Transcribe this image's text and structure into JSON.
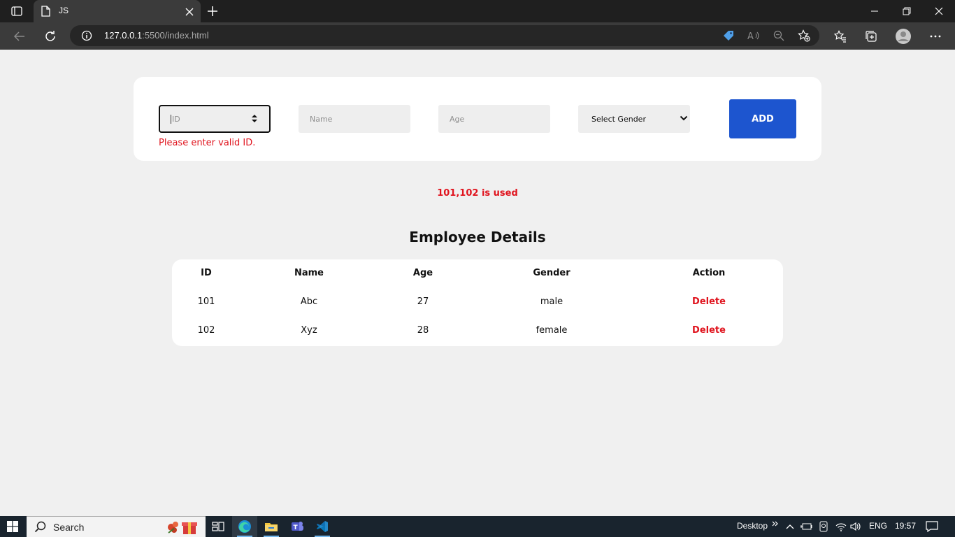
{
  "browser": {
    "tab_title": "JS",
    "url_host": "127.0.0.1",
    "url_path": ":5500/index.html"
  },
  "form": {
    "id_placeholder": "ID",
    "name_placeholder": "Name",
    "age_placeholder": "Age",
    "gender_selected": "Select Gender",
    "add_label": "ADD",
    "error_text": "Please enter valid ID."
  },
  "used_message": "101,102 is used",
  "table": {
    "title": "Employee Details",
    "headers": [
      "ID",
      "Name",
      "Age",
      "Gender",
      "Action"
    ],
    "rows": [
      {
        "id": "101",
        "name": "Abc",
        "age": "27",
        "gender": "male",
        "action": "Delete"
      },
      {
        "id": "102",
        "name": "Xyz",
        "age": "28",
        "gender": "female",
        "action": "Delete"
      }
    ]
  },
  "taskbar": {
    "search_label": "Search",
    "desktop_label": "Desktop",
    "language": "ENG",
    "time": "19:57"
  },
  "colors": {
    "accent_button": "#1d55cf",
    "error": "#e0141e",
    "page_bg": "#f0f0f0"
  }
}
